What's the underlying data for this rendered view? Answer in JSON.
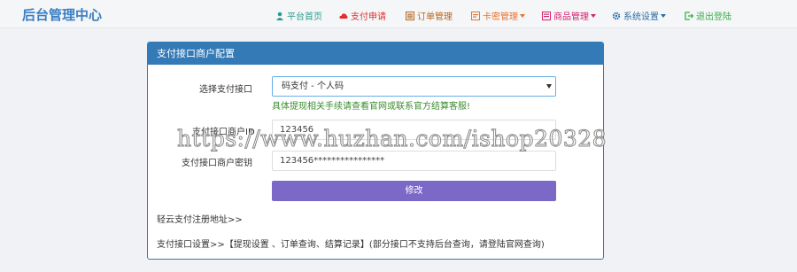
{
  "app": {
    "title": "后台管理中心"
  },
  "nav": {
    "items": [
      {
        "label": "平台首页",
        "icon": "user-icon",
        "color": "#2a9d8f"
      },
      {
        "label": "支付申请",
        "icon": "cloud-icon",
        "color": "#e0302b"
      },
      {
        "label": "订单管理",
        "icon": "list-icon",
        "color": "#b8651e"
      },
      {
        "label": "卡密管理",
        "icon": "card-icon",
        "color": "#e8742c"
      },
      {
        "label": "商品管理",
        "icon": "goods-icon",
        "color": "#d6236f"
      },
      {
        "label": "系统设置",
        "icon": "gear-icon",
        "color": "#2c6ea8"
      },
      {
        "label": "退出登陆",
        "icon": "logout-icon",
        "color": "#3bb04a"
      }
    ]
  },
  "panel": {
    "title": "支付接口商户配置",
    "form": {
      "interface_label": "选择支付接口",
      "interface_value": "码支付 - 个人码",
      "hint": "具体提现相关手续请查看官网或联系官方结算客服!",
      "merchant_id_label": "支付接口商户ID",
      "merchant_id_value": "123456",
      "merchant_key_label": "支付接口商户密钥",
      "merchant_key_value": "123456****************",
      "submit_label": "修改"
    },
    "register_link": "轻云支付注册地址>>",
    "settings_line": "支付接口设置>>【提现设置 、订单查询、结算记录】(部分接口不支持后台查询，请登陆官网查询)"
  },
  "watermark": "https://www.huzhan.com/ishop20328",
  "colors": {
    "primary": "#337ab7",
    "button": "#7b68c7",
    "hint": "#3c8d2f"
  }
}
